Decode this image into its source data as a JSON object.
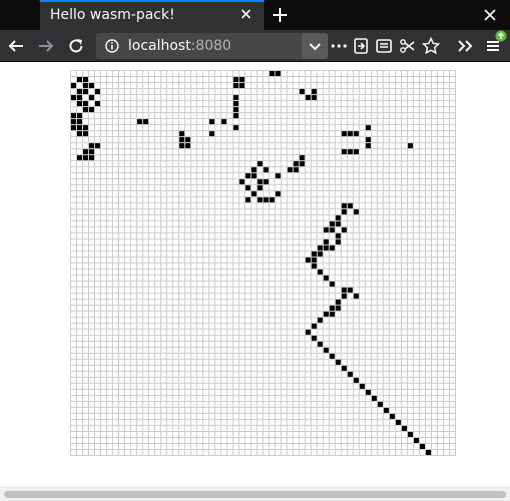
{
  "browser": {
    "tab_title": "Hello wasm-pack!",
    "url_host": "localhost",
    "url_port": ":8080",
    "icons": [
      "close-tab-icon",
      "new-tab-icon",
      "window-close-icon",
      "back-icon",
      "forward-icon",
      "reload-icon",
      "site-info-icon",
      "url-dropdown-icon",
      "page-actions-icon",
      "library-icon",
      "sidebar-icon",
      "screenshot-icon",
      "bookmark-star-icon",
      "overflow-chevron-icon",
      "menu-icon",
      "update-badge-icon"
    ],
    "accent": "#0a84ff",
    "update_badge_color": "#57bd35"
  },
  "game": {
    "grid_size": 64,
    "cell_color": "#000000",
    "grid_color": "#cccccc",
    "background": "#ffffff",
    "live_cells": [
      [
        0,
        33
      ],
      [
        0,
        34
      ],
      [
        1,
        1
      ],
      [
        1,
        2
      ],
      [
        1,
        27
      ],
      [
        1,
        28
      ],
      [
        2,
        0
      ],
      [
        2,
        2
      ],
      [
        2,
        3
      ],
      [
        2,
        27
      ],
      [
        2,
        28
      ],
      [
        3,
        1
      ],
      [
        3,
        2
      ],
      [
        3,
        4
      ],
      [
        3,
        38
      ],
      [
        3,
        40
      ],
      [
        4,
        0
      ],
      [
        4,
        1
      ],
      [
        4,
        3
      ],
      [
        4,
        27
      ],
      [
        4,
        39
      ],
      [
        4,
        40
      ],
      [
        5,
        1
      ],
      [
        5,
        2
      ],
      [
        5,
        4
      ],
      [
        5,
        27
      ],
      [
        6,
        2
      ],
      [
        6,
        3
      ],
      [
        6,
        27
      ],
      [
        7,
        0
      ],
      [
        7,
        1
      ],
      [
        7,
        27
      ],
      [
        8,
        0
      ],
      [
        8,
        1
      ],
      [
        8,
        11
      ],
      [
        8,
        12
      ],
      [
        8,
        23
      ],
      [
        8,
        25
      ],
      [
        9,
        0
      ],
      [
        9,
        1
      ],
      [
        9,
        2
      ],
      [
        9,
        27
      ],
      [
        9,
        49
      ],
      [
        10,
        1
      ],
      [
        10,
        2
      ],
      [
        10,
        18
      ],
      [
        10,
        23
      ],
      [
        10,
        45
      ],
      [
        10,
        46
      ],
      [
        10,
        47
      ],
      [
        11,
        18
      ],
      [
        11,
        19
      ],
      [
        11,
        49
      ],
      [
        12,
        3
      ],
      [
        12,
        4
      ],
      [
        12,
        18
      ],
      [
        12,
        19
      ],
      [
        12,
        49
      ],
      [
        12,
        56
      ],
      [
        13,
        2
      ],
      [
        13,
        3
      ],
      [
        13,
        45
      ],
      [
        13,
        46
      ],
      [
        13,
        47
      ],
      [
        14,
        1
      ],
      [
        14,
        2
      ],
      [
        14,
        3
      ],
      [
        14,
        38
      ],
      [
        15,
        31
      ],
      [
        15,
        37
      ],
      [
        15,
        38
      ],
      [
        16,
        30
      ],
      [
        16,
        32
      ],
      [
        16,
        36
      ],
      [
        16,
        37
      ],
      [
        17,
        29
      ],
      [
        17,
        30
      ],
      [
        17,
        34
      ],
      [
        18,
        28
      ],
      [
        18,
        31
      ],
      [
        18,
        32
      ],
      [
        19,
        29
      ],
      [
        19,
        31
      ],
      [
        20,
        30
      ],
      [
        20,
        34
      ],
      [
        21,
        29
      ],
      [
        21,
        31
      ],
      [
        21,
        32
      ],
      [
        21,
        33
      ],
      [
        22,
        45
      ],
      [
        22,
        46
      ],
      [
        23,
        45
      ],
      [
        23,
        47
      ],
      [
        24,
        44
      ],
      [
        25,
        43
      ],
      [
        25,
        44
      ],
      [
        26,
        42
      ],
      [
        26,
        43
      ],
      [
        26,
        45
      ],
      [
        27,
        44
      ],
      [
        28,
        42
      ],
      [
        28,
        44
      ],
      [
        29,
        41
      ],
      [
        29,
        42
      ],
      [
        29,
        43
      ],
      [
        30,
        40
      ],
      [
        30,
        41
      ],
      [
        31,
        39
      ],
      [
        31,
        40
      ],
      [
        32,
        40
      ],
      [
        33,
        41
      ],
      [
        34,
        42
      ],
      [
        35,
        43
      ],
      [
        36,
        45
      ],
      [
        36,
        46
      ],
      [
        37,
        45
      ],
      [
        37,
        47
      ],
      [
        38,
        44
      ],
      [
        39,
        43
      ],
      [
        39,
        44
      ],
      [
        40,
        42
      ],
      [
        40,
        43
      ],
      [
        41,
        41
      ],
      [
        42,
        40
      ],
      [
        43,
        39
      ],
      [
        44,
        40
      ],
      [
        45,
        41
      ],
      [
        46,
        42
      ],
      [
        47,
        43
      ],
      [
        48,
        44
      ],
      [
        49,
        45
      ],
      [
        50,
        46
      ],
      [
        51,
        47
      ],
      [
        52,
        48
      ],
      [
        53,
        49
      ],
      [
        54,
        50
      ],
      [
        55,
        51
      ],
      [
        56,
        52
      ],
      [
        57,
        53
      ],
      [
        58,
        54
      ],
      [
        59,
        55
      ],
      [
        60,
        56
      ],
      [
        61,
        57
      ],
      [
        62,
        58
      ],
      [
        63,
        59
      ]
    ]
  }
}
